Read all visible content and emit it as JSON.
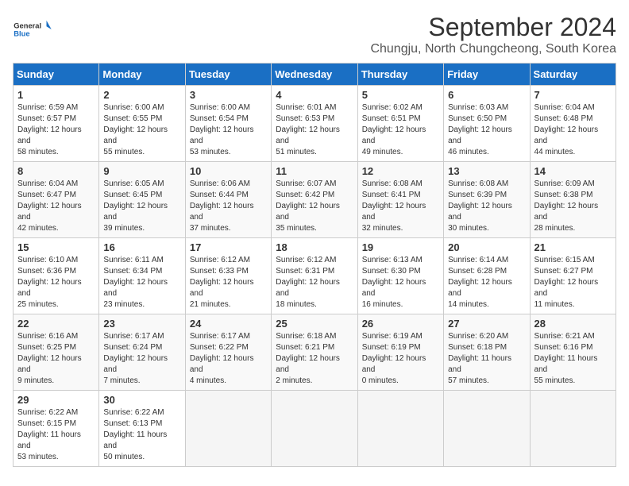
{
  "header": {
    "logo_general": "General",
    "logo_blue": "Blue",
    "month_year": "September 2024",
    "location": "Chungju, North Chungcheong, South Korea"
  },
  "days_of_week": [
    "Sunday",
    "Monday",
    "Tuesday",
    "Wednesday",
    "Thursday",
    "Friday",
    "Saturday"
  ],
  "weeks": [
    [
      {
        "day": 1,
        "sunrise": "6:59 AM",
        "sunset": "6:57 PM",
        "daylight": "12 hours and 58 minutes."
      },
      {
        "day": 2,
        "sunrise": "6:00 AM",
        "sunset": "6:55 PM",
        "daylight": "12 hours and 55 minutes."
      },
      {
        "day": 3,
        "sunrise": "6:00 AM",
        "sunset": "6:54 PM",
        "daylight": "12 hours and 53 minutes."
      },
      {
        "day": 4,
        "sunrise": "6:01 AM",
        "sunset": "6:53 PM",
        "daylight": "12 hours and 51 minutes."
      },
      {
        "day": 5,
        "sunrise": "6:02 AM",
        "sunset": "6:51 PM",
        "daylight": "12 hours and 49 minutes."
      },
      {
        "day": 6,
        "sunrise": "6:03 AM",
        "sunset": "6:50 PM",
        "daylight": "12 hours and 46 minutes."
      },
      {
        "day": 7,
        "sunrise": "6:04 AM",
        "sunset": "6:48 PM",
        "daylight": "12 hours and 44 minutes."
      }
    ],
    [
      {
        "day": 8,
        "sunrise": "6:04 AM",
        "sunset": "6:47 PM",
        "daylight": "12 hours and 42 minutes."
      },
      {
        "day": 9,
        "sunrise": "6:05 AM",
        "sunset": "6:45 PM",
        "daylight": "12 hours and 39 minutes."
      },
      {
        "day": 10,
        "sunrise": "6:06 AM",
        "sunset": "6:44 PM",
        "daylight": "12 hours and 37 minutes."
      },
      {
        "day": 11,
        "sunrise": "6:07 AM",
        "sunset": "6:42 PM",
        "daylight": "12 hours and 35 minutes."
      },
      {
        "day": 12,
        "sunrise": "6:08 AM",
        "sunset": "6:41 PM",
        "daylight": "12 hours and 32 minutes."
      },
      {
        "day": 13,
        "sunrise": "6:08 AM",
        "sunset": "6:39 PM",
        "daylight": "12 hours and 30 minutes."
      },
      {
        "day": 14,
        "sunrise": "6:09 AM",
        "sunset": "6:38 PM",
        "daylight": "12 hours and 28 minutes."
      }
    ],
    [
      {
        "day": 15,
        "sunrise": "6:10 AM",
        "sunset": "6:36 PM",
        "daylight": "12 hours and 25 minutes."
      },
      {
        "day": 16,
        "sunrise": "6:11 AM",
        "sunset": "6:34 PM",
        "daylight": "12 hours and 23 minutes."
      },
      {
        "day": 17,
        "sunrise": "6:12 AM",
        "sunset": "6:33 PM",
        "daylight": "12 hours and 21 minutes."
      },
      {
        "day": 18,
        "sunrise": "6:12 AM",
        "sunset": "6:31 PM",
        "daylight": "12 hours and 18 minutes."
      },
      {
        "day": 19,
        "sunrise": "6:13 AM",
        "sunset": "6:30 PM",
        "daylight": "12 hours and 16 minutes."
      },
      {
        "day": 20,
        "sunrise": "6:14 AM",
        "sunset": "6:28 PM",
        "daylight": "12 hours and 14 minutes."
      },
      {
        "day": 21,
        "sunrise": "6:15 AM",
        "sunset": "6:27 PM",
        "daylight": "12 hours and 11 minutes."
      }
    ],
    [
      {
        "day": 22,
        "sunrise": "6:16 AM",
        "sunset": "6:25 PM",
        "daylight": "12 hours and 9 minutes."
      },
      {
        "day": 23,
        "sunrise": "6:17 AM",
        "sunset": "6:24 PM",
        "daylight": "12 hours and 7 minutes."
      },
      {
        "day": 24,
        "sunrise": "6:17 AM",
        "sunset": "6:22 PM",
        "daylight": "12 hours and 4 minutes."
      },
      {
        "day": 25,
        "sunrise": "6:18 AM",
        "sunset": "6:21 PM",
        "daylight": "12 hours and 2 minutes."
      },
      {
        "day": 26,
        "sunrise": "6:19 AM",
        "sunset": "6:19 PM",
        "daylight": "12 hours and 0 minutes."
      },
      {
        "day": 27,
        "sunrise": "6:20 AM",
        "sunset": "6:18 PM",
        "daylight": "11 hours and 57 minutes."
      },
      {
        "day": 28,
        "sunrise": "6:21 AM",
        "sunset": "6:16 PM",
        "daylight": "11 hours and 55 minutes."
      }
    ],
    [
      {
        "day": 29,
        "sunrise": "6:22 AM",
        "sunset": "6:15 PM",
        "daylight": "11 hours and 53 minutes."
      },
      {
        "day": 30,
        "sunrise": "6:22 AM",
        "sunset": "6:13 PM",
        "daylight": "11 hours and 50 minutes."
      },
      null,
      null,
      null,
      null,
      null
    ]
  ]
}
